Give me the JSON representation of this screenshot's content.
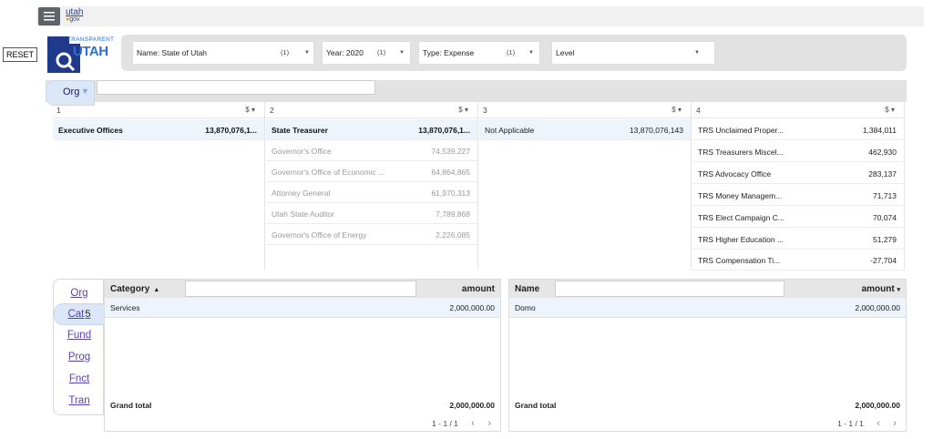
{
  "header": {
    "logo_top": "utah",
    "logo_bottom": "gov"
  },
  "reset_label": "RESET",
  "brand": {
    "top": "TRANSPARENT",
    "main": "UTAH"
  },
  "filters": [
    {
      "key": "Name",
      "value": "State of Utah",
      "count": "(1)"
    },
    {
      "key": "Year",
      "value": "2020",
      "count": "(1)"
    },
    {
      "key": "Type",
      "value": "Expense",
      "count": "(1)"
    },
    {
      "key": "Level",
      "value": "",
      "count": ""
    }
  ],
  "org_tab": {
    "label": "Org"
  },
  "columns": [
    {
      "num": "1",
      "currency": "$",
      "rows": [
        {
          "name": "Executive Offices",
          "value": "13,870,076,1..."
        }
      ]
    },
    {
      "num": "2",
      "currency": "$",
      "rows": [
        {
          "name": "State Treasurer",
          "value": "13,870,076,1..."
        },
        {
          "name": "Governor's Office",
          "value": "74,539,227"
        },
        {
          "name": "Governor's Office of Economic ...",
          "value": "64,864,865"
        },
        {
          "name": "Attorney General",
          "value": "61,970,313"
        },
        {
          "name": "Utah State Auditor",
          "value": "7,789,868"
        },
        {
          "name": "Governor's Office of Energy",
          "value": "2,226,085"
        }
      ]
    },
    {
      "num": "3",
      "currency": "$",
      "rows": [
        {
          "name": "Not Applicable",
          "value": "13,870,076,143"
        }
      ]
    },
    {
      "num": "4",
      "currency": "$",
      "rows": [
        {
          "name": "TRS Unclaimed Proper...",
          "value": "1,384,011"
        },
        {
          "name": "TRS Treasurers Miscel...",
          "value": "462,930"
        },
        {
          "name": "TRS Advocacy Office",
          "value": "283,137"
        },
        {
          "name": "TRS Money Managem...",
          "value": "71,713"
        },
        {
          "name": "TRS Elect Campaign C...",
          "value": "70,074"
        },
        {
          "name": "TRS Higher Education ...",
          "value": "51,279"
        },
        {
          "name": "TRS Compensation Ti...",
          "value": "-27,704"
        }
      ]
    }
  ],
  "side_tabs": [
    {
      "label": "Org"
    },
    {
      "label": "Cat",
      "badge": "5"
    },
    {
      "label": "Fund"
    },
    {
      "label": "Prog"
    },
    {
      "label": "Fnct"
    },
    {
      "label": "Tran"
    }
  ],
  "category_table": {
    "col1": "Category",
    "col2": "amount",
    "row": {
      "c1": "Services",
      "c2": "2,000,000.00"
    },
    "total_label": "Grand total",
    "total_value": "2,000,000.00",
    "pager": "1 - 1 / 1"
  },
  "name_table": {
    "col1": "Name",
    "col2": "amount",
    "row": {
      "c1": "Domo",
      "c2": "2,000,000.00"
    },
    "total_label": "Grand total",
    "total_value": "2,000,000.00",
    "pager": "1 - 1 / 1"
  },
  "colors": {
    "accent": "#2a6fd6",
    "tab_bg": "#dbe7f6",
    "link": "#5a3fb5"
  }
}
